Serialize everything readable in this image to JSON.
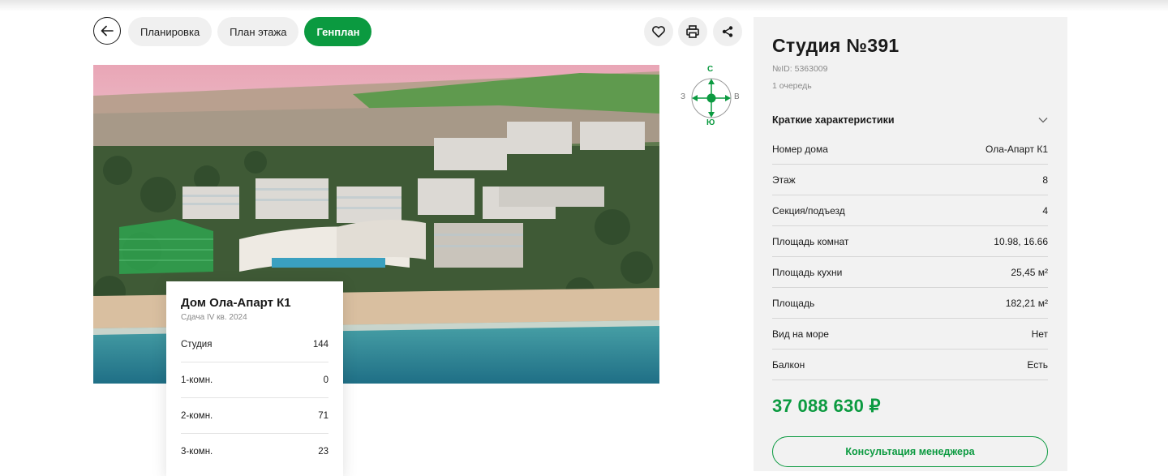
{
  "tabs": [
    {
      "label": "Планировка",
      "active": false
    },
    {
      "label": "План этажа",
      "active": false
    },
    {
      "label": "Генплан",
      "active": true
    }
  ],
  "icons": {
    "back": "arrow-left-icon",
    "favorite": "heart-icon",
    "print": "printer-icon",
    "share": "share-icon",
    "accordion": "chevron-down-icon"
  },
  "compass": {
    "north": "С",
    "south": "Ю",
    "west": "З",
    "east": "В"
  },
  "house_card": {
    "title": "Дом Ола-Апарт К1",
    "subtitle": "Сдача IV кв. 2024",
    "rows": [
      {
        "label": "Студия",
        "value": "144"
      },
      {
        "label": "1-комн.",
        "value": "0"
      },
      {
        "label": "2-комн.",
        "value": "71"
      },
      {
        "label": "3-комн.",
        "value": "23"
      }
    ]
  },
  "apartment": {
    "title": "Студия №391",
    "id_text": "№ID: 5363009",
    "queue": "1 очередь",
    "section_title": "Краткие характеристики",
    "specs": [
      {
        "label": "Номер дома",
        "value": "Ола-Апарт К1"
      },
      {
        "label": "Этаж",
        "value": "8"
      },
      {
        "label": "Секция/подъезд",
        "value": "4"
      },
      {
        "label": "Площадь комнат",
        "value": "10.98, 16.66"
      },
      {
        "label": "Площадь кухни",
        "value": "25,45 м²"
      },
      {
        "label": "Площадь",
        "value": "182,21 м²"
      },
      {
        "label": "Вид на море",
        "value": "Нет"
      },
      {
        "label": "Балкон",
        "value": "Есть"
      }
    ],
    "price": "37 088 630 ₽",
    "consult_label": "Консультация менеджера"
  },
  "colors": {
    "accent": "#0b9a40",
    "panel_bg": "#f2f2f2",
    "tab_bg": "#f0f0f0"
  }
}
